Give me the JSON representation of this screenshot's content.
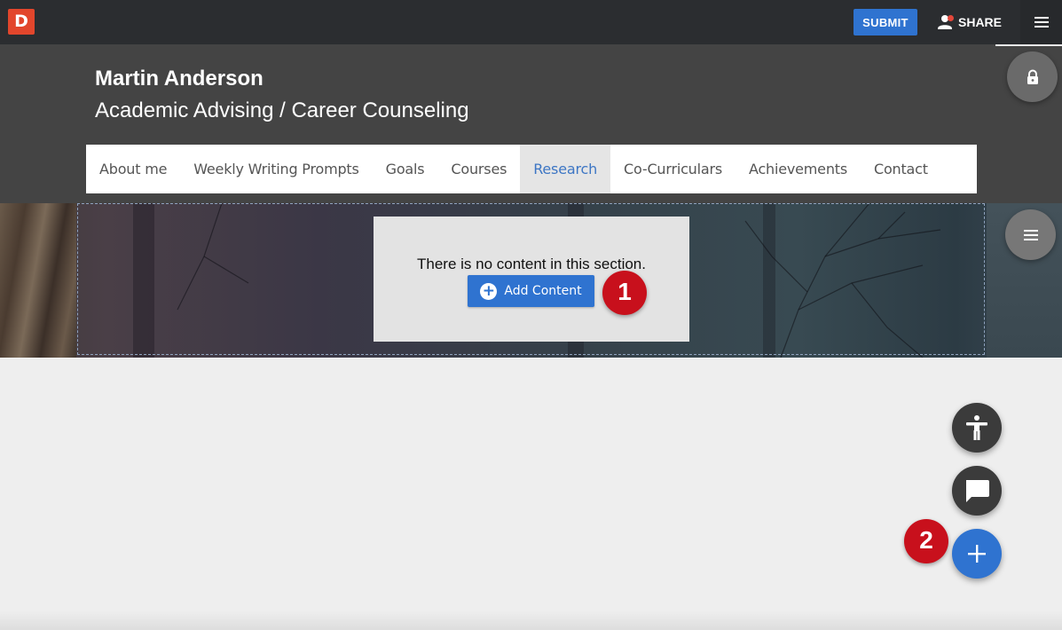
{
  "topbar": {
    "logo_letter": "D",
    "submit_label": "SUBMIT",
    "share_label": "SHARE",
    "colors": {
      "bar": "#2b2d30",
      "logo": "#e2462c",
      "accent": "#2f73d0",
      "notification": "#e5473a"
    }
  },
  "header": {
    "name": "Martin Anderson",
    "subtitle": "Academic Advising / Career Counseling"
  },
  "nav": {
    "items": [
      {
        "label": "About me"
      },
      {
        "label": "Weekly Writing Prompts"
      },
      {
        "label": "Goals"
      },
      {
        "label": "Courses"
      },
      {
        "label": "Research"
      },
      {
        "label": "Co-Curriculars"
      },
      {
        "label": "Achievements"
      },
      {
        "label": "Contact"
      }
    ],
    "active": "Research"
  },
  "section": {
    "empty_message": "There is no content in this section.",
    "add_content_label": "Add Content"
  },
  "callouts": {
    "one": "1",
    "two": "2"
  },
  "icons": {
    "menu": "hamburger-icon",
    "lock": "lock-icon",
    "section_menu": "hamburger-icon",
    "accessibility": "accessibility-icon",
    "chat": "chat-icon",
    "add": "plus-icon",
    "share": "person-icon"
  }
}
